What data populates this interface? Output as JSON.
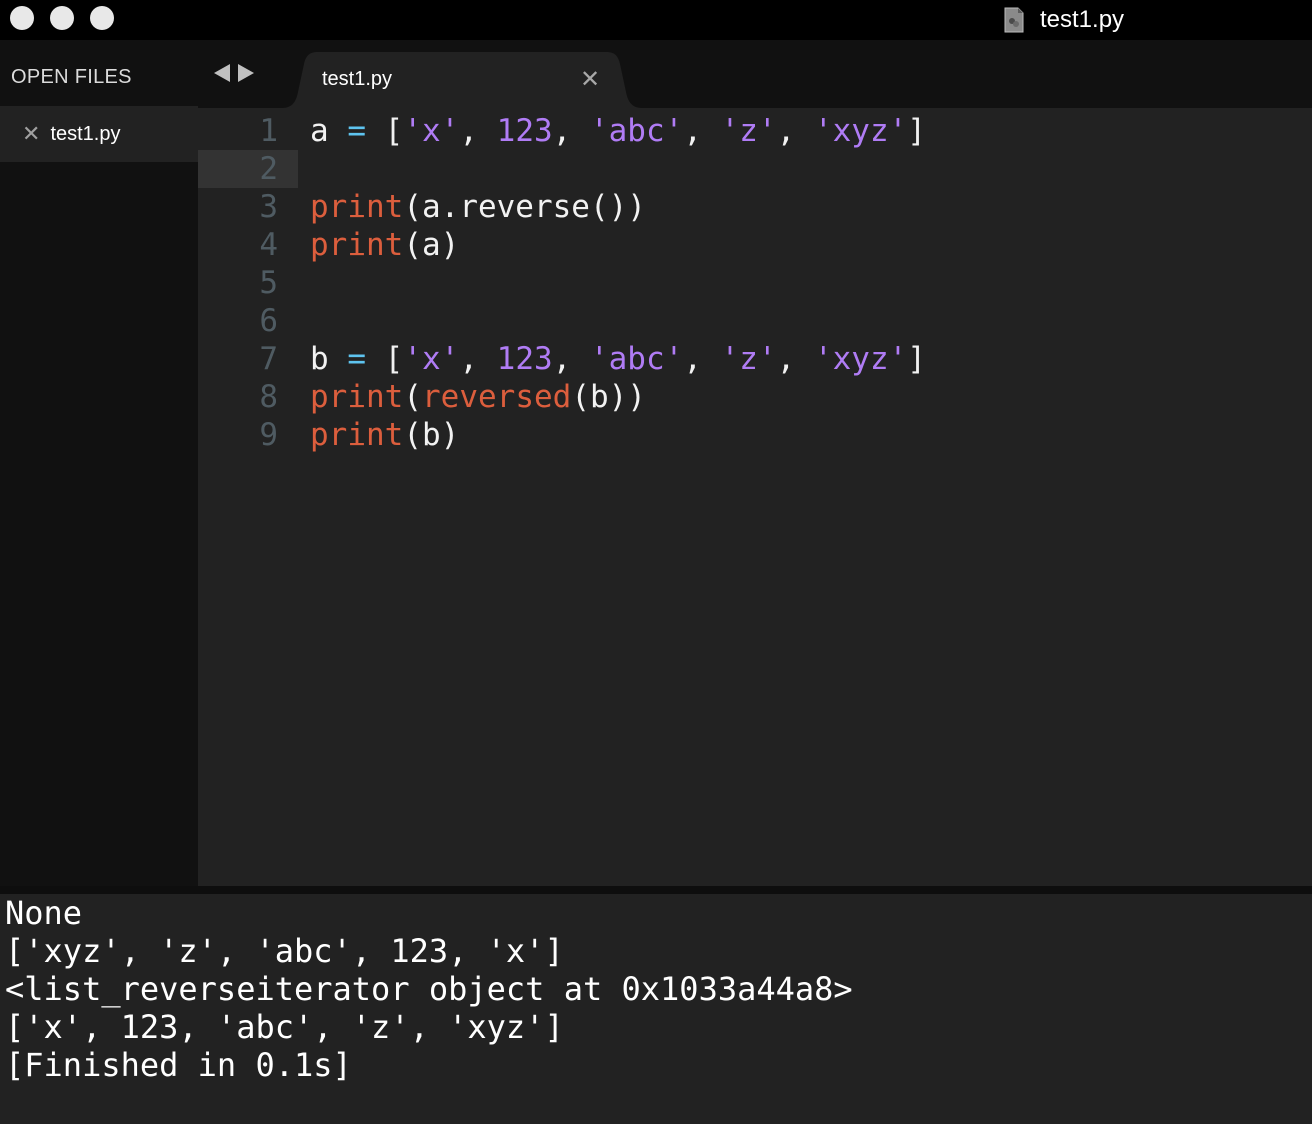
{
  "window": {
    "title": "test1.py"
  },
  "sidebar": {
    "header": "OPEN FILES",
    "files": [
      {
        "label": "test1.py",
        "close": "✕"
      }
    ]
  },
  "tabs": [
    {
      "label": "test1.py",
      "close": "✕",
      "active": true
    }
  ],
  "editor": {
    "line_numbers": [
      "1",
      "2",
      "3",
      "4",
      "5",
      "6",
      "7",
      "8",
      "9"
    ],
    "current_line": "2",
    "lines": [
      [
        {
          "t": "plain",
          "v": "a "
        },
        {
          "t": "op",
          "v": "="
        },
        {
          "t": "plain",
          "v": " ["
        },
        {
          "t": "str",
          "v": "'x'"
        },
        {
          "t": "plain",
          "v": ", "
        },
        {
          "t": "num",
          "v": "123"
        },
        {
          "t": "plain",
          "v": ", "
        },
        {
          "t": "str",
          "v": "'abc'"
        },
        {
          "t": "plain",
          "v": ", "
        },
        {
          "t": "str",
          "v": "'z'"
        },
        {
          "t": "plain",
          "v": ", "
        },
        {
          "t": "str",
          "v": "'xyz'"
        },
        {
          "t": "plain",
          "v": "]"
        }
      ],
      [],
      [
        {
          "t": "fn",
          "v": "print"
        },
        {
          "t": "plain",
          "v": "(a.reverse())"
        }
      ],
      [
        {
          "t": "fn",
          "v": "print"
        },
        {
          "t": "plain",
          "v": "(a)"
        }
      ],
      [],
      [],
      [
        {
          "t": "plain",
          "v": "b "
        },
        {
          "t": "op",
          "v": "="
        },
        {
          "t": "plain",
          "v": " ["
        },
        {
          "t": "str",
          "v": "'x'"
        },
        {
          "t": "plain",
          "v": ", "
        },
        {
          "t": "num",
          "v": "123"
        },
        {
          "t": "plain",
          "v": ", "
        },
        {
          "t": "str",
          "v": "'abc'"
        },
        {
          "t": "plain",
          "v": ", "
        },
        {
          "t": "str",
          "v": "'z'"
        },
        {
          "t": "plain",
          "v": ", "
        },
        {
          "t": "str",
          "v": "'xyz'"
        },
        {
          "t": "plain",
          "v": "]"
        }
      ],
      [
        {
          "t": "fn",
          "v": "print"
        },
        {
          "t": "plain",
          "v": "("
        },
        {
          "t": "fn",
          "v": "reversed"
        },
        {
          "t": "plain",
          "v": "(b))"
        }
      ],
      [
        {
          "t": "fn",
          "v": "print"
        },
        {
          "t": "plain",
          "v": "(b)"
        }
      ]
    ]
  },
  "output": {
    "lines": [
      "None",
      "['xyz', 'z', 'abc', 123, 'x']",
      "<list_reverseiterator object at 0x1033a44a8>",
      "['x', 123, 'abc', 'z', 'xyz']",
      "[Finished in 0.1s]"
    ]
  },
  "colors": {
    "function": "#dc5e3d",
    "string": "#b07cf5",
    "number": "#b07cf5",
    "operator": "#5ec4f0",
    "text": "#f2f2f2"
  },
  "icons": {
    "nav_back": "chevron-left-icon",
    "nav_forward": "chevron-right-icon",
    "tab_close": "close-icon",
    "file": "python-file-icon"
  }
}
